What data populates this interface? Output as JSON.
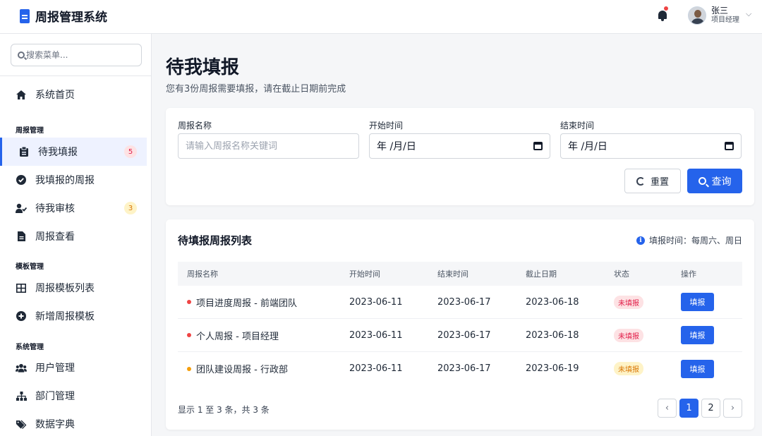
{
  "app": {
    "title": "周报管理系统"
  },
  "user": {
    "name": "张三",
    "role": "项目经理"
  },
  "sidebar": {
    "search_placeholder": "搜索菜单...",
    "home": "系统首页",
    "groups": [
      {
        "title": "周报管理",
        "items": [
          {
            "label": "待我填报",
            "count": "5",
            "icon": "clipboard-icon",
            "active": true
          },
          {
            "label": "我填报的周报",
            "icon": "check-circle-icon"
          },
          {
            "label": "待我审核",
            "count": "3",
            "icon": "user-check-icon"
          },
          {
            "label": "周报查看",
            "icon": "file-icon"
          }
        ]
      },
      {
        "title": "模板管理",
        "items": [
          {
            "label": "周报模板列表",
            "icon": "grid-icon"
          },
          {
            "label": "新增周报模板",
            "icon": "plus-circle-icon"
          }
        ]
      },
      {
        "title": "系统管理",
        "items": [
          {
            "label": "用户管理",
            "icon": "users-icon"
          },
          {
            "label": "部门管理",
            "icon": "sitemap-icon"
          },
          {
            "label": "数据字典",
            "icon": "tags-icon"
          }
        ]
      }
    ]
  },
  "page": {
    "title": "待我填报",
    "subtitle": "您有3份周报需要填报，请在截止日期前完成"
  },
  "filter": {
    "name_label": "周报名称",
    "name_placeholder": "请输入周报名称关键词",
    "start_label": "开始时间",
    "start_value": "年 /月/日",
    "end_label": "结束时间",
    "end_value": "年 /月/日",
    "reset_label": "重置",
    "query_label": "查询"
  },
  "list": {
    "title": "待填报周报列表",
    "fill_time": "填报时间：每周六、周日",
    "columns": [
      "周报名称",
      "开始时间",
      "结束时间",
      "截止日期",
      "状态",
      "操作"
    ],
    "rows": [
      {
        "name": "项目进度周报 - 前端团队",
        "start": "2023-06-11",
        "end": "2023-06-17",
        "deadline": "2023-06-18",
        "status": "未填报",
        "action": "填报",
        "color": "#ef4444"
      },
      {
        "name": "个人周报 - 项目经理",
        "start": "2023-06-11",
        "end": "2023-06-17",
        "deadline": "2023-06-18",
        "status": "未填报",
        "action": "填报",
        "color": "#ef4444"
      },
      {
        "name": "团队建设周报 - 行政部",
        "start": "2023-06-11",
        "end": "2023-06-17",
        "deadline": "2023-06-19",
        "status": "未填报",
        "action": "填报",
        "color": "#f59e0b"
      }
    ],
    "summary": "显示 1 至 3 条，共 3 条",
    "pages": [
      "1",
      "2"
    ],
    "current_page": "1"
  },
  "colors": {
    "primary": "#2563eb",
    "danger": "#ef4444",
    "warning": "#f59e0b"
  }
}
